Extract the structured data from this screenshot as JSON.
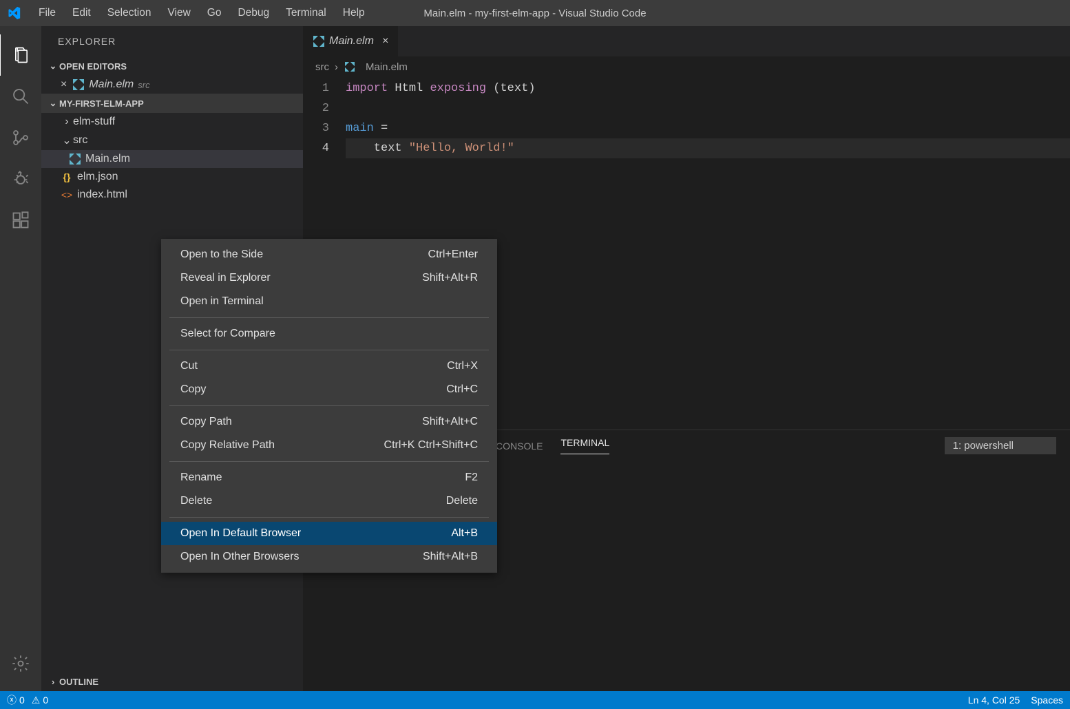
{
  "window": {
    "title": "Main.elm - my-first-elm-app - Visual Studio Code"
  },
  "menu": [
    "File",
    "Edit",
    "Selection",
    "View",
    "Go",
    "Debug",
    "Terminal",
    "Help"
  ],
  "sidebar": {
    "title": "EXPLORER",
    "open_editors_label": "OPEN EDITORS",
    "open_editors": {
      "file": "Main.elm",
      "dir": "src"
    },
    "project_label": "MY-FIRST-ELM-APP",
    "tree": {
      "elm_stuff": "elm-stuff",
      "src": "src",
      "main": "Main.elm",
      "elm_json": "elm.json",
      "index": "index.html"
    },
    "outline_label": "OUTLINE"
  },
  "tab": {
    "label": "Main.elm"
  },
  "breadcrumb": {
    "dir": "src",
    "file": "Main.elm"
  },
  "code": {
    "lines": [
      "1",
      "2",
      "3",
      "4"
    ],
    "l1": {
      "a": "import",
      "b": " Html ",
      "c": "exposing",
      "d": " (text)"
    },
    "l3": {
      "a": "main",
      "b": " ="
    },
    "l4": {
      "a": "    text ",
      "b": "\"Hello, World!\""
    }
  },
  "panel": {
    "console": "CONSOLE",
    "terminal": "TERMINAL",
    "select": "1: powershell"
  },
  "context_menu": [
    {
      "label": "Open to the Side",
      "shortcut": "Ctrl+Enter"
    },
    {
      "label": "Reveal in Explorer",
      "shortcut": "Shift+Alt+R"
    },
    {
      "label": "Open in Terminal",
      "shortcut": ""
    },
    {
      "sep": true
    },
    {
      "label": "Select for Compare",
      "shortcut": ""
    },
    {
      "sep": true
    },
    {
      "label": "Cut",
      "shortcut": "Ctrl+X"
    },
    {
      "label": "Copy",
      "shortcut": "Ctrl+C"
    },
    {
      "sep": true
    },
    {
      "label": "Copy Path",
      "shortcut": "Shift+Alt+C"
    },
    {
      "label": "Copy Relative Path",
      "shortcut": "Ctrl+K Ctrl+Shift+C"
    },
    {
      "sep": true
    },
    {
      "label": "Rename",
      "shortcut": "F2"
    },
    {
      "label": "Delete",
      "shortcut": "Delete"
    },
    {
      "sep": true
    },
    {
      "label": "Open In Default Browser",
      "shortcut": "Alt+B",
      "selected": true
    },
    {
      "label": "Open In Other Browsers",
      "shortcut": "Shift+Alt+B"
    }
  ],
  "status": {
    "errors": "0",
    "warnings": "0",
    "pos": "Ln 4, Col 25",
    "spaces": "Spaces"
  }
}
